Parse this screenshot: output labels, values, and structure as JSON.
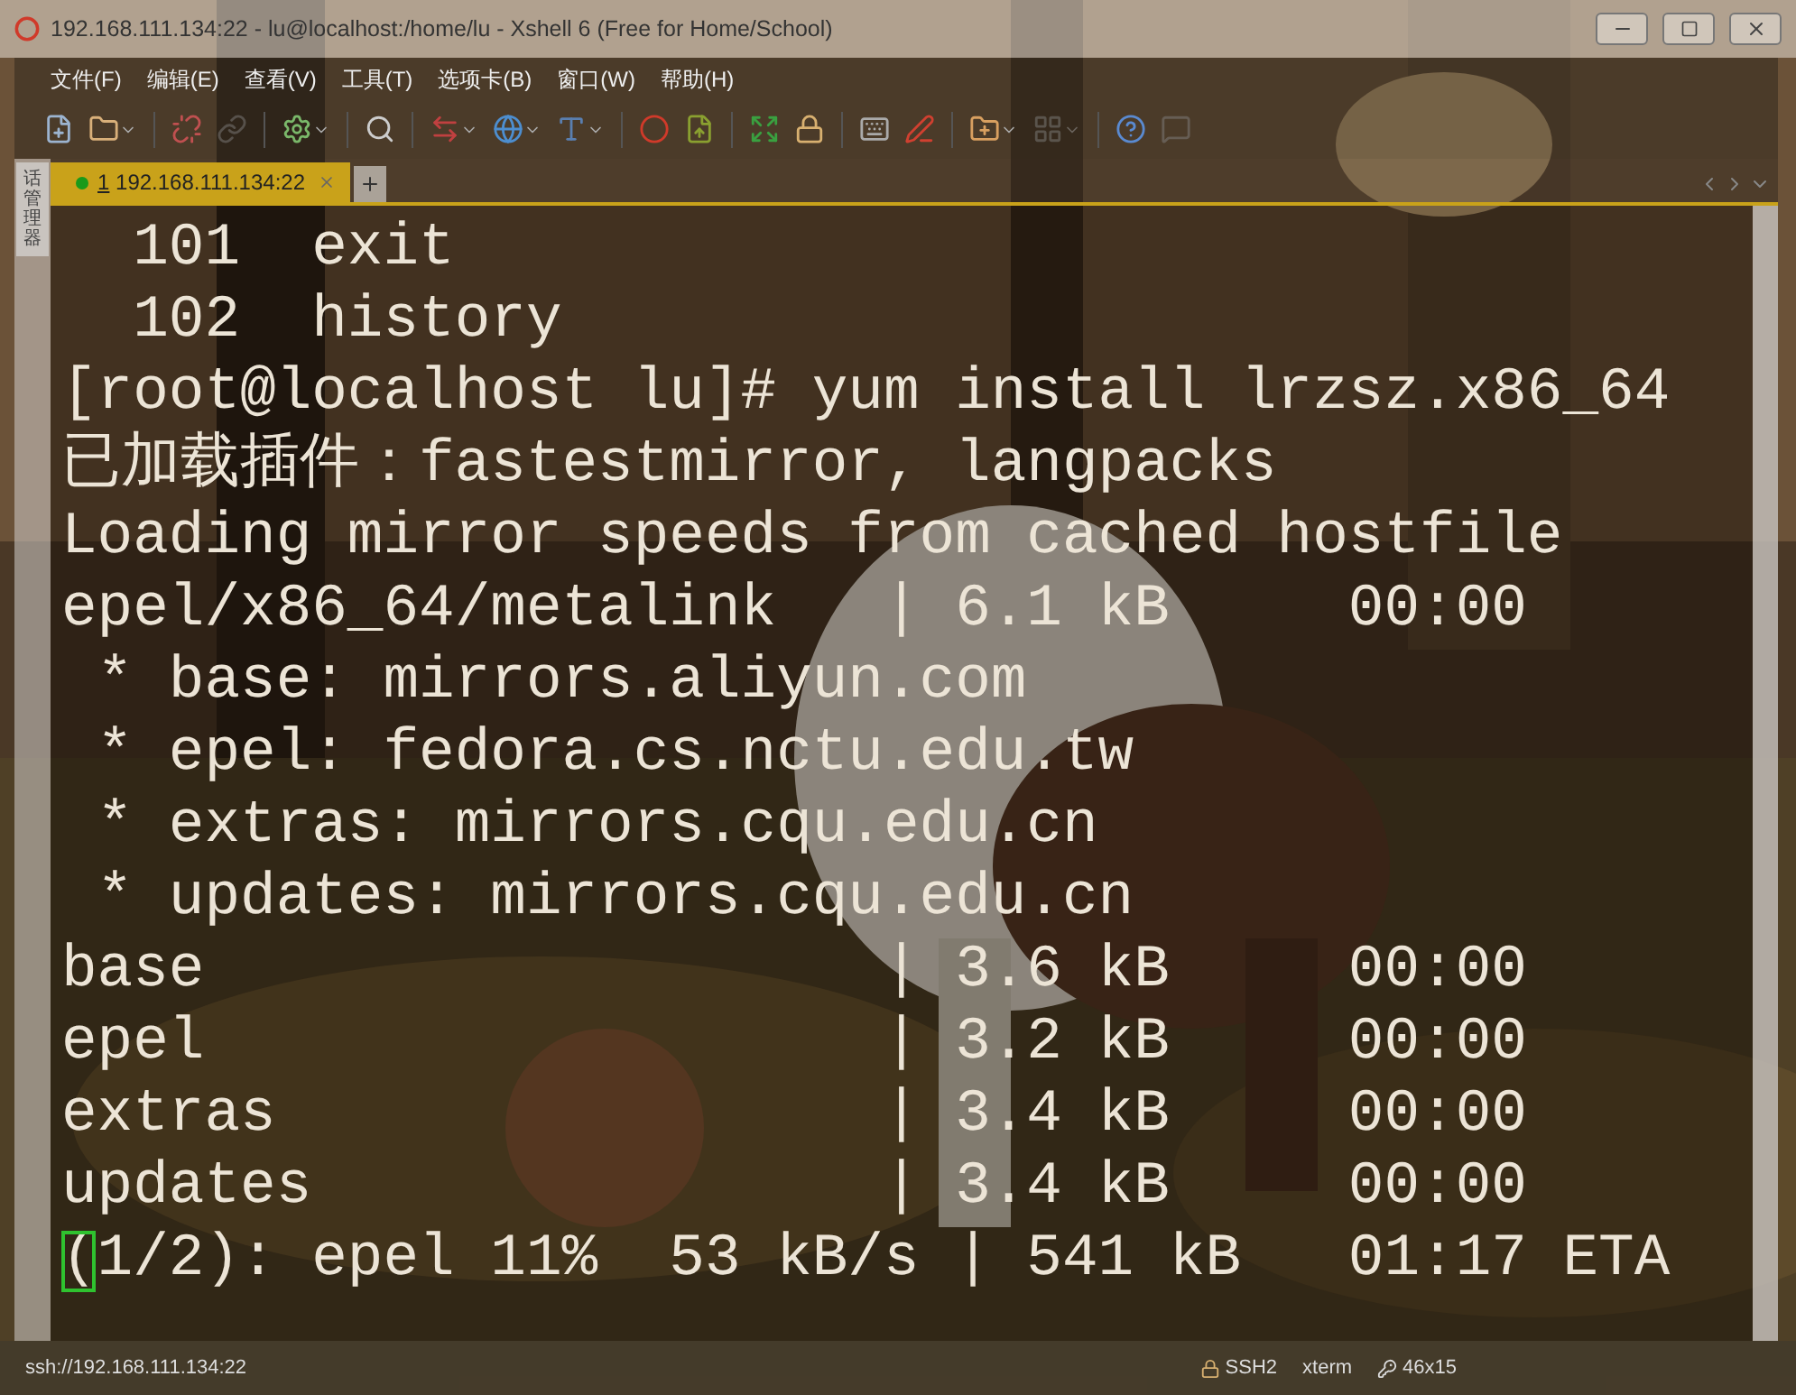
{
  "window": {
    "title": "192.168.111.134:22 - lu@localhost:/home/lu - Xshell 6 (Free for Home/School)"
  },
  "menu": [
    "文件(F)",
    "编辑(E)",
    "查看(V)",
    "工具(T)",
    "选项卡(B)",
    "窗口(W)",
    "帮助(H)"
  ],
  "side_panel": {
    "label": "话管理器"
  },
  "tabs": [
    {
      "number": "1",
      "label": " 192.168.111.134:22",
      "selected": true,
      "connected": true
    }
  ],
  "terminal": {
    "lines": [
      {
        "text": "  101  exit",
        "cursor": false
      },
      {
        "text": "  102  history",
        "cursor": false
      },
      {
        "text": "[root@localhost lu]# yum install lrzsz.x86_64",
        "cursor": false
      },
      {
        "text": "已加载插件：fastestmirror, langpacks",
        "cursor": false
      },
      {
        "text": "Loading mirror speeds from cached hostfile",
        "cursor": false
      },
      {
        "text": "epel/x86_64/metalink   | 6.1 kB     00:00",
        "cursor": false
      },
      {
        "text": " * base: mirrors.aliyun.com",
        "cursor": false
      },
      {
        "text": " * epel: fedora.cs.nctu.edu.tw",
        "cursor": false
      },
      {
        "text": " * extras: mirrors.cqu.edu.cn",
        "cursor": false
      },
      {
        "text": " * updates: mirrors.cqu.edu.cn",
        "cursor": false
      },
      {
        "text": "base                   | 3.6 kB     00:00",
        "cursor": false
      },
      {
        "text": "epel                   | 3.2 kB     00:00",
        "cursor": false
      },
      {
        "text": "extras                 | 3.4 kB     00:00",
        "cursor": false
      },
      {
        "text": "updates                | 3.4 kB     00:00",
        "cursor": false
      },
      {
        "text": "(1/2): epel 11%  53 kB/s | 541 kB   01:17 ETA",
        "cursor": true
      }
    ]
  },
  "status_bar": {
    "address": "ssh://192.168.111.134:22",
    "protocol": "SSH2",
    "terminal_type": "xterm",
    "size": "46x15"
  }
}
